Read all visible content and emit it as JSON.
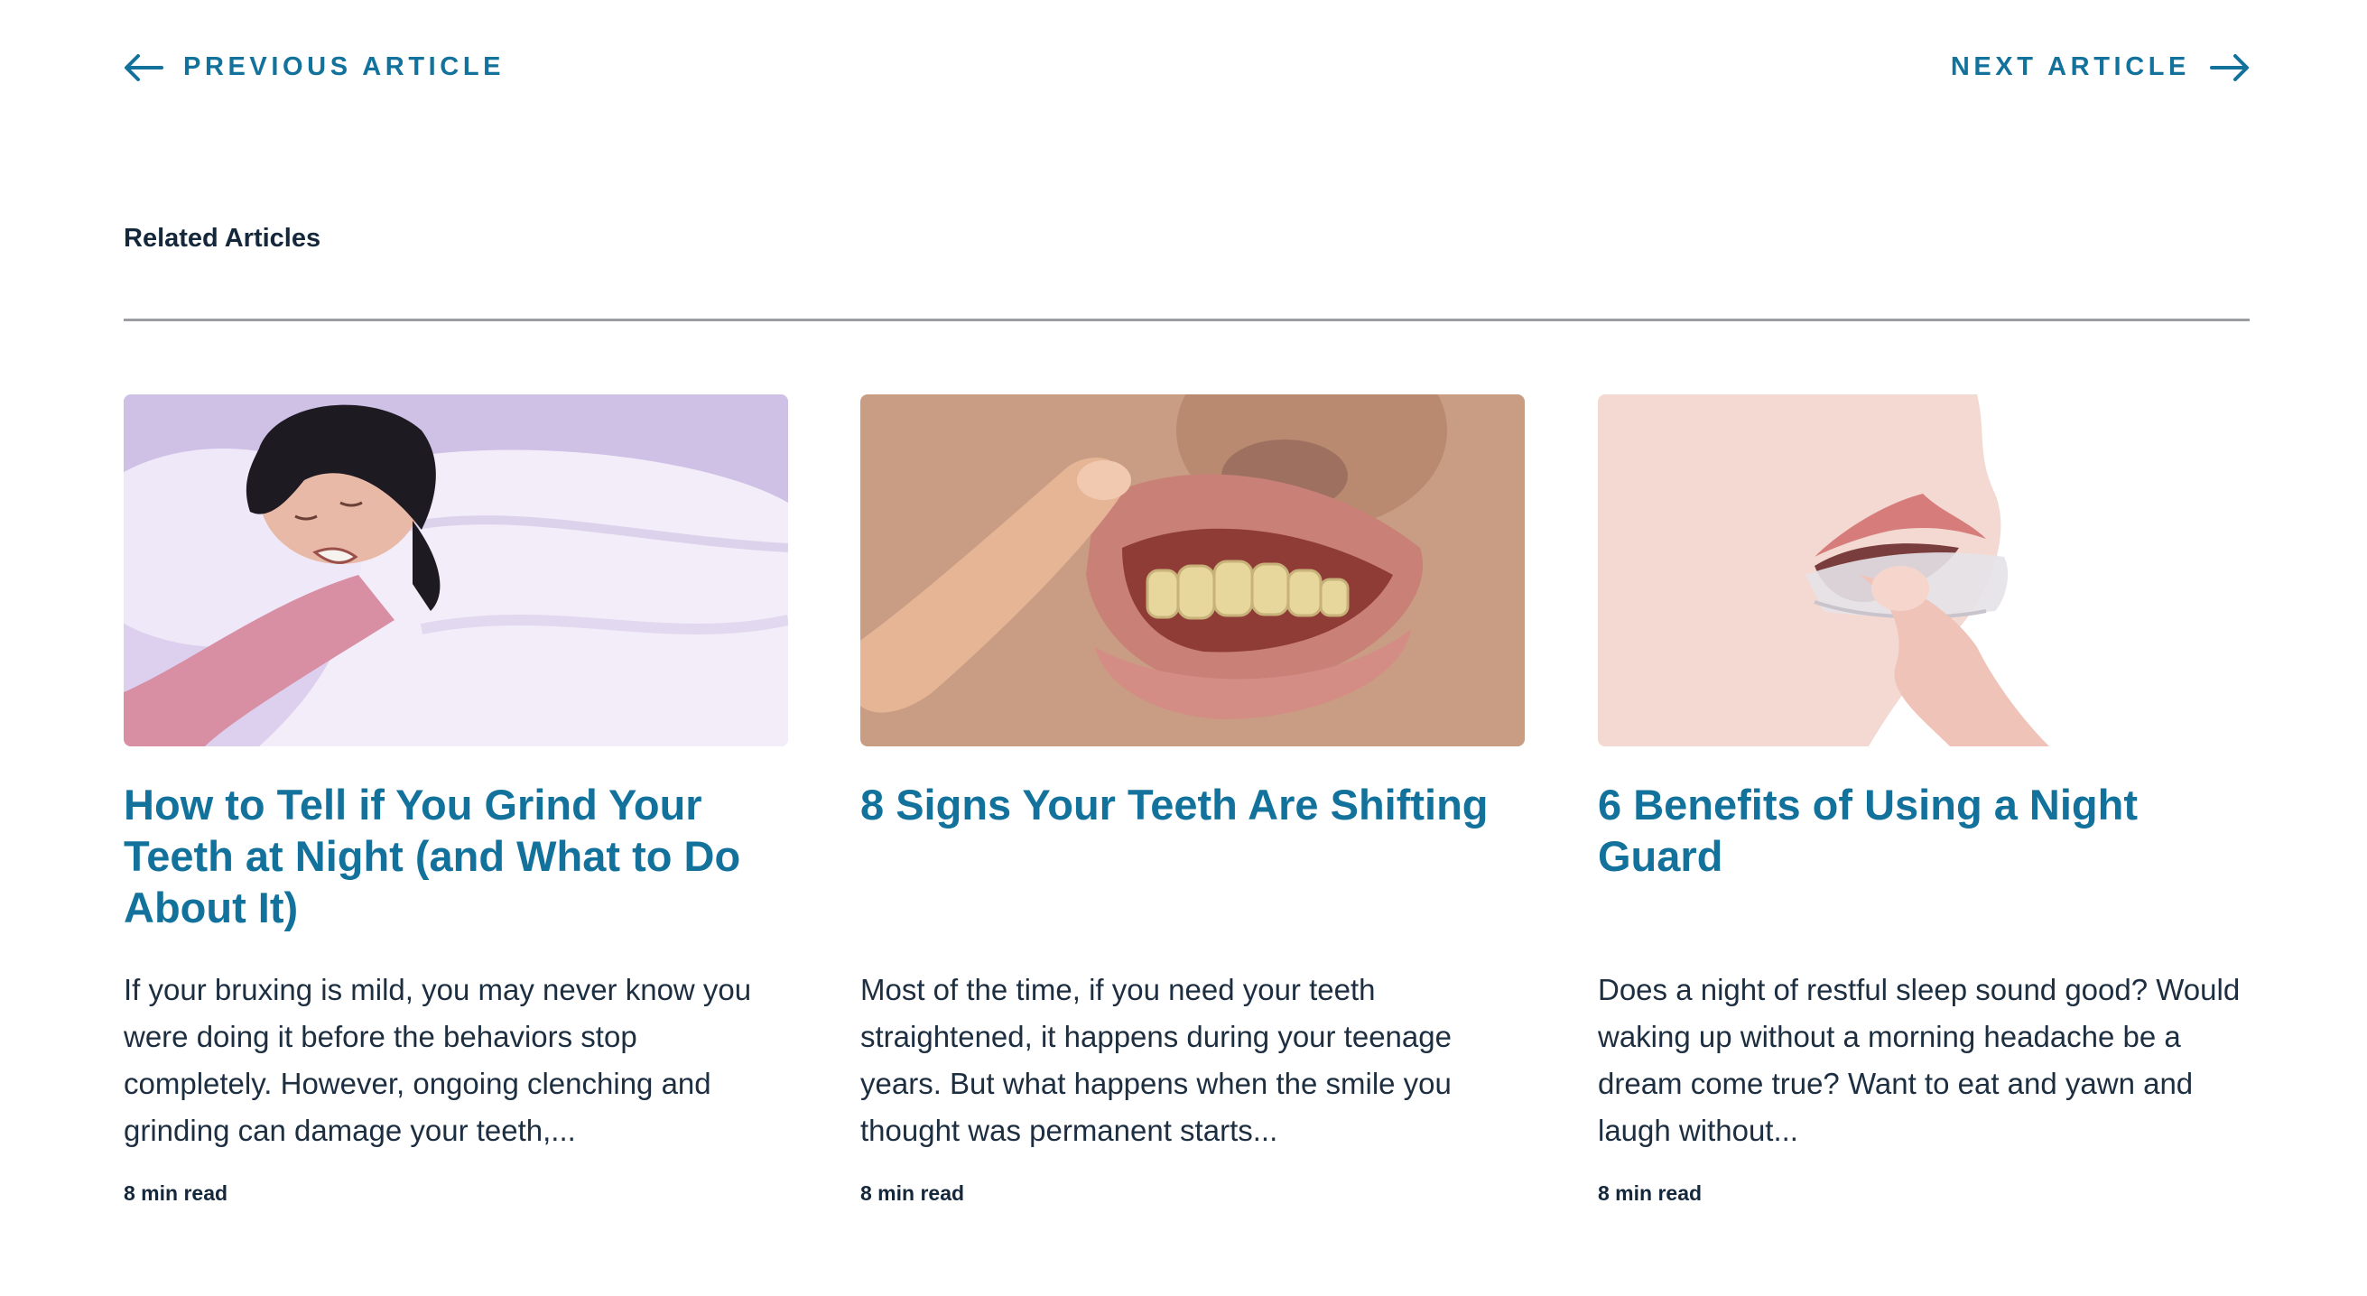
{
  "nav": {
    "previous_label": "PREVIOUS ARTICLE",
    "next_label": "NEXT ARTICLE",
    "accent_color": "#13729c"
  },
  "related": {
    "heading": "Related Articles",
    "articles": [
      {
        "title": "How to Tell if You Grind Your Teeth at Night (and What to Do About It)",
        "excerpt": "If your bruxing is mild, you may never know you were doing it before the behaviors stop completely. However, ongoing clenching and grinding can damage your teeth,...",
        "read_time": "8 min read",
        "image": "woman-sleeping-grinding-teeth-photo"
      },
      {
        "title": "8 Signs Your Teeth Are Shifting",
        "excerpt": "Most of the time, if you need your teeth straightened, it happens during your teenage years. But what happens when the smile you thought was permanent starts...",
        "read_time": "8 min read",
        "image": "finger-lifting-lip-showing-teeth-photo"
      },
      {
        "title": "6 Benefits of Using a Night Guard",
        "excerpt": "Does a night of restful sleep sound good? Would waking up without a morning headache be a dream come true? Want to eat and yawn and laugh without...",
        "read_time": "8 min read",
        "image": "inserting-clear-night-guard-photo"
      }
    ]
  }
}
